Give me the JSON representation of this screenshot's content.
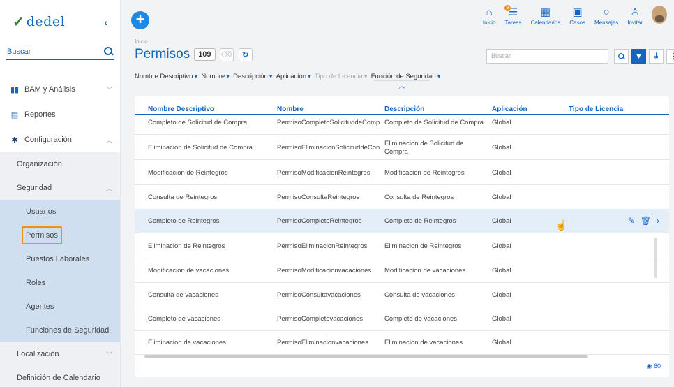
{
  "app": {
    "logo_text": "dedel"
  },
  "sidebar": {
    "search_placeholder": "Buscar",
    "items": [
      {
        "label": "BAM y Análisis",
        "icon": "chart-icon"
      },
      {
        "label": "Reportes",
        "icon": "reports-icon"
      },
      {
        "label": "Configuración",
        "icon": "gear-icon"
      },
      {
        "label": "Organización"
      },
      {
        "label": "Seguridad"
      },
      {
        "label": "Usuarios"
      },
      {
        "label": "Permisos"
      },
      {
        "label": "Puestos Laborales"
      },
      {
        "label": "Roles"
      },
      {
        "label": "Agentes"
      },
      {
        "label": "Funciones de Seguridad"
      },
      {
        "label": "Localización"
      },
      {
        "label": "Definición de Calendario"
      }
    ]
  },
  "topbar": {
    "actions": [
      {
        "label": "Inicio",
        "icon": "home-icon"
      },
      {
        "label": "Tareas",
        "icon": "tasks-icon",
        "badge": "9"
      },
      {
        "label": "Calendarios",
        "icon": "calendar-icon"
      },
      {
        "label": "Casos",
        "icon": "briefcase-icon"
      },
      {
        "label": "Mensajes",
        "icon": "message-icon"
      },
      {
        "label": "Invitar",
        "icon": "invite-icon"
      }
    ]
  },
  "header": {
    "breadcrumb": "Inicio",
    "title": "Permisos",
    "count": "109",
    "search_placeholder": "Buscar"
  },
  "column_selector": {
    "items": [
      {
        "label": "Nombre Descriptivo",
        "active": true
      },
      {
        "label": "Nombre",
        "active": true
      },
      {
        "label": "Descripción",
        "active": true
      },
      {
        "label": "Aplicación",
        "active": true
      },
      {
        "label": "Tipo de Licencia",
        "active": false
      },
      {
        "label": "Función de Seguridad",
        "active": true
      }
    ]
  },
  "table": {
    "headers": [
      "Nombre Descriptivo",
      "Nombre",
      "Descripción",
      "Aplicación",
      "Tipo de Licencia"
    ],
    "rows": [
      [
        "Completo de Solicitud de Compra",
        "PermisoCompletoSolicituddeComp",
        "Completo de Solicitud de Compra",
        "Global"
      ],
      [
        "Eliminacion de Solicitud de Compra",
        "PermisoEliminacionSolicituddeCon",
        "Eliminacion de Solicitud de Compra",
        "Global"
      ],
      [
        "Modificacion de Reintegros",
        "PermisoModificacionReintegros",
        "Modificacion de Reintegros",
        "Global"
      ],
      [
        "Consulta de Reintegros",
        "PermisoConsultaReintegros",
        "Consulta de Reintegros",
        "Global"
      ],
      [
        "Completo de Reintegros",
        "PermisoCompletoReintegros",
        "Completo de Reintegros",
        "Global"
      ],
      [
        "Eliminacion de Reintegros",
        "PermisoEliminacionReintegros",
        "Eliminacion de Reintegros",
        "Global"
      ],
      [
        "Modificacion de vacaciones",
        "PermisoModificacionvacaciones",
        "Modificacion de vacaciones",
        "Global"
      ],
      [
        "Consulta de vacaciones",
        "PermisoConsultavacaciones",
        "Consulta de vacaciones",
        "Global"
      ],
      [
        "Completo de vacaciones",
        "PermisoCompletovacaciones",
        "Completo de vacaciones",
        "Global"
      ],
      [
        "Eliminacion de vacaciones",
        "PermisoEliminacionvacaciones",
        "Eliminacion de vacaciones",
        "Global"
      ]
    ]
  },
  "footer": {
    "view_count": "60"
  }
}
